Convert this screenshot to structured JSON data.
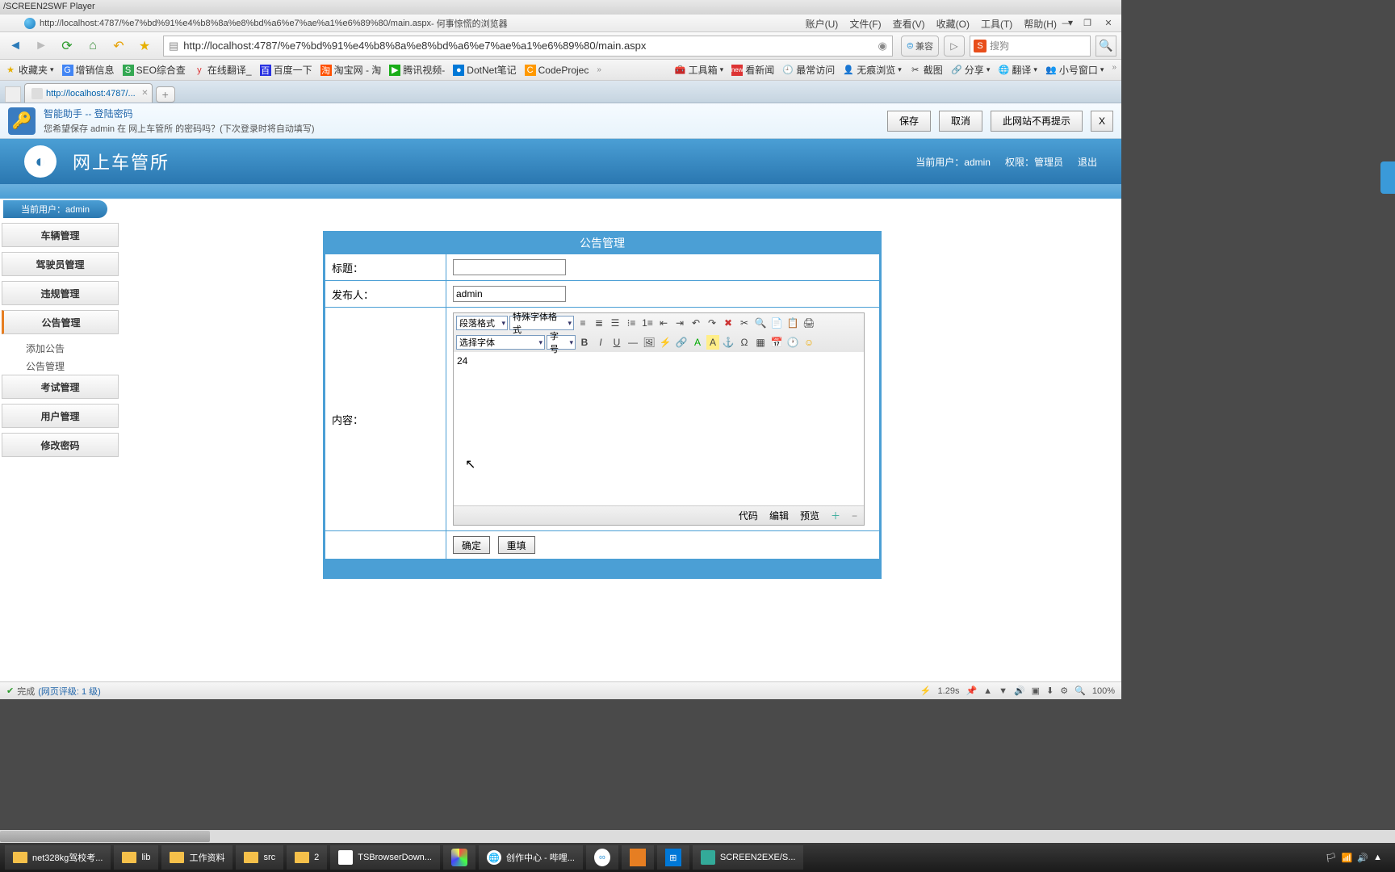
{
  "player": {
    "title": "/SCREEN2SWF Player"
  },
  "browser": {
    "title_url": "http://localhost:4787/%e7%bd%91%e4%b8%8a%e8%bd%a6%e7%ae%a1%e6%89%80/main.aspx",
    "title_suffix": " - 何事惊慌的浏览器",
    "menus": [
      "账户(U)",
      "文件(F)",
      "查看(V)",
      "收藏(O)",
      "工具(T)",
      "帮助(H)"
    ],
    "url": "http://localhost:4787/%e7%bd%91%e4%b8%8a%e8%bd%a6%e7%ae%a1%e6%89%80/main.aspx",
    "compat": "兼容",
    "search_placeholder": "搜狗",
    "bookmarks_left": {
      "fav": "收藏夹",
      "items": [
        "增销信息",
        "SEO综合查",
        "在线翻译_",
        "百度一下",
        "淘宝网 - 淘",
        "腾讯视频-",
        "DotNet笔记",
        "CodeProjec"
      ]
    },
    "bookmarks_right": [
      "工具箱",
      "看新闻",
      "最常访问",
      "无痕浏览",
      "截图",
      "分享",
      "翻译",
      "小号窗口"
    ],
    "tab_label": "http://localhost:4787/..."
  },
  "pwbar": {
    "title": "智能助手 -- 登陆密码",
    "msg": "您希望保存 admin 在 网上车管所 的密码吗？(下次登录时将自动填写)",
    "btn_save": "保存",
    "btn_cancel": "取消",
    "btn_never": "此网站不再提示",
    "btn_x": "X"
  },
  "page": {
    "title": "网上车管所",
    "user_label": "当前用户：",
    "user": "admin",
    "role_label": "权限：",
    "role": "管理员",
    "logout": "退出",
    "crumb": "当前用户：admin"
  },
  "sidebar": {
    "items": [
      "车辆管理",
      "驾驶员管理",
      "违规管理",
      "公告管理",
      "考试管理",
      "用户管理",
      "修改密码"
    ],
    "subs": [
      "添加公告",
      "公告管理"
    ]
  },
  "form": {
    "panel_title": "公告管理",
    "label_title": "标题：",
    "label_pub": "发布人：",
    "label_content": "内容：",
    "title_value": "",
    "publisher_value": "admin",
    "editor_content": "24",
    "btn_ok": "确定",
    "btn_reset": "重填"
  },
  "editor": {
    "sel1": "段落格式",
    "sel2": "特殊字体格式",
    "sel3": "选择字体",
    "sel4": "字号",
    "foot": [
      "代码",
      "编辑",
      "预览"
    ]
  },
  "status": {
    "done": "完成",
    "rating": "(网页评级: 1 级)",
    "time": "1.29s",
    "zoom": "100%"
  },
  "taskbar": {
    "items": [
      "net328kg驾校考...",
      "lib",
      "工作资料",
      "src",
      "2",
      "TSBrowserDown...",
      "创作中心 - 哔哩...",
      "SCREEN2EXE/S..."
    ]
  }
}
